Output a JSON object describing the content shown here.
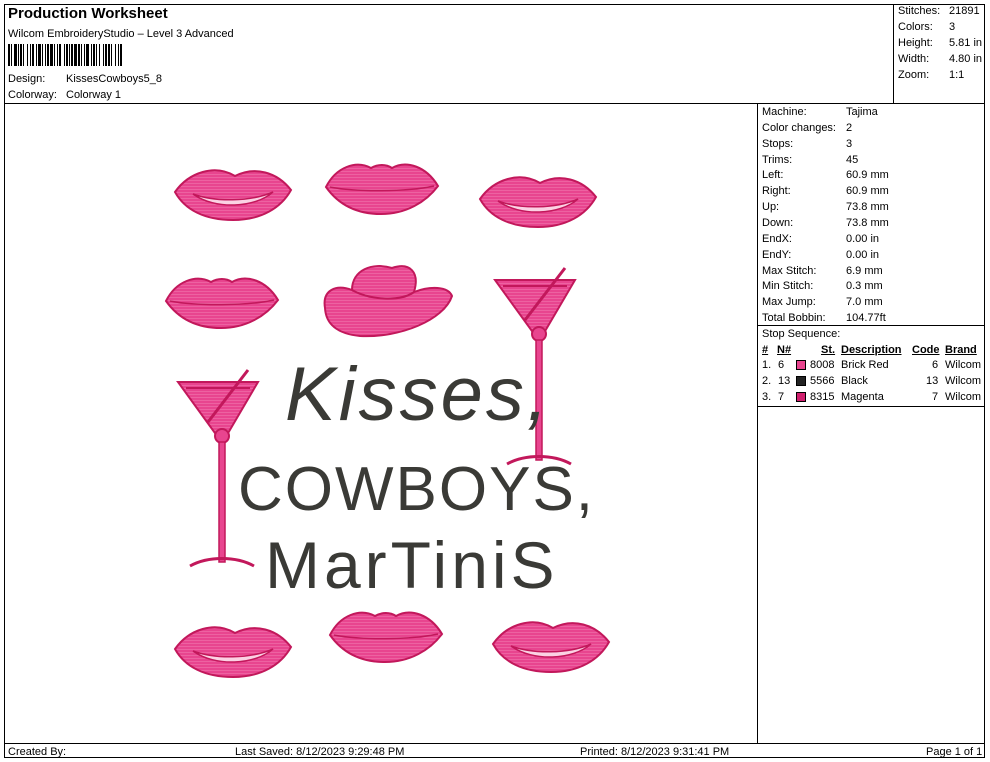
{
  "header": {
    "title": "Production Worksheet",
    "software": "Wilcom EmbroideryStudio – Level 3 Advanced",
    "design_label": "Design:",
    "design_value": "KissesCowboys5_8",
    "colorway_label": "Colorway:",
    "colorway_value": "Colorway 1"
  },
  "summary": [
    {
      "label": "Stitches:",
      "value": "21891"
    },
    {
      "label": "Colors:",
      "value": "3"
    },
    {
      "label": "Height:",
      "value": "5.81 in"
    },
    {
      "label": "Width:",
      "value": "4.80 in"
    },
    {
      "label": "Zoom:",
      "value": "1:1"
    }
  ],
  "details": [
    {
      "label": "Machine:",
      "value": "Tajima"
    },
    {
      "label": "Color changes:",
      "value": "2"
    },
    {
      "label": "Stops:",
      "value": "3"
    },
    {
      "label": "Trims:",
      "value": "45"
    },
    {
      "label": "Left:",
      "value": "60.9 mm"
    },
    {
      "label": "Right:",
      "value": "60.9 mm"
    },
    {
      "label": "Up:",
      "value": "73.8 mm"
    },
    {
      "label": "Down:",
      "value": "73.8 mm"
    },
    {
      "label": "EndX:",
      "value": "0.00 in"
    },
    {
      "label": "EndY:",
      "value": "0.00 in"
    },
    {
      "label": "Max Stitch:",
      "value": "6.9 mm"
    },
    {
      "label": "Min Stitch:",
      "value": "0.3 mm"
    },
    {
      "label": "Max Jump:",
      "value": "7.0 mm"
    },
    {
      "label": "Total Bobbin:",
      "value": "104.77ft"
    }
  ],
  "stop_sequence": {
    "title": "Stop Sequence:",
    "headers": {
      "num": "#",
      "n": "N#",
      "st": "St.",
      "desc": "Description",
      "code": "Code",
      "brand": "Brand"
    },
    "rows": [
      {
        "num": "1.",
        "n": "6",
        "color": "#e8458f",
        "st": "8008",
        "desc": "Brick Red",
        "code": "6",
        "brand": "Wilcom"
      },
      {
        "num": "2.",
        "n": "13",
        "color": "#222222",
        "st": "5566",
        "desc": "Black",
        "code": "13",
        "brand": "Wilcom"
      },
      {
        "num": "3.",
        "n": "7",
        "color": "#d01f6e",
        "st": "8315",
        "desc": "Magenta",
        "code": "7",
        "brand": "Wilcom"
      }
    ]
  },
  "design_text": {
    "line1": "Kisses,",
    "line2": "COWBOYS,",
    "line3": "MarTiniS"
  },
  "footer": {
    "created": "Created By:",
    "saved": "Last Saved: 8/12/2023 9:29:48 PM",
    "printed": "Printed: 8/12/2023 9:31:41 PM",
    "page": "Page 1 of 1"
  },
  "colors": {
    "pink": "#e8458f",
    "pink_dark": "#c2185b",
    "thread_black": "#3a3a36"
  }
}
